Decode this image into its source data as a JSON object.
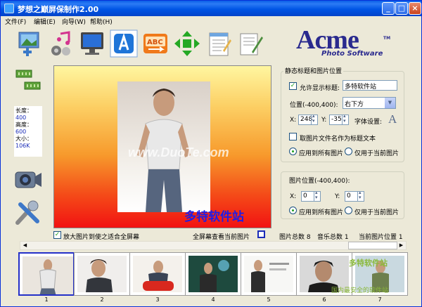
{
  "window": {
    "title": "梦想之巅屏保制作2.00",
    "min": "_",
    "max": "□",
    "close": "×"
  },
  "menu": [
    "文件(F)",
    "编辑(E)",
    "向导(W)",
    "帮助(H)"
  ],
  "logo": {
    "name": "Acme",
    "tm": "TM",
    "subtitle": "Photo Software"
  },
  "toolbar_icons": [
    "add-photo-icon",
    "music-icon",
    "monitor-icon",
    "text-a-icon",
    "abc-icon",
    "move-arrows-icon",
    "notepad-icon",
    "document-edit-icon"
  ],
  "side_icons": [
    "music-track-icon",
    "camera-icon",
    "tools-icon"
  ],
  "info": {
    "length_label": "长度：",
    "length_value": "400",
    "height_label": "高度：",
    "height_value": "600",
    "size_label": "大小：",
    "size_value": "106K"
  },
  "preview": {
    "caption": "多特软件站",
    "watermark": "www.DuoTe.com"
  },
  "title_group": {
    "legend": "静态标题和图片位置",
    "show_title_label": "允许显示标题:",
    "show_title_checked": true,
    "title_value": "多特软件站",
    "position_label": "位置(-400,400):",
    "position_select": "右下方",
    "x_label": "X:",
    "x_value": "248",
    "y_label": "Y:",
    "y_value": "-35",
    "font_label": "字体设置:",
    "font_glyph": "A",
    "use_filename_label": "取图片文件名作为标题文本",
    "apply_all_label": "应用到所有图片",
    "apply_current_label": "仅用于当前图片"
  },
  "image_group": {
    "legend": "图片位置(-400,400):",
    "x_label": "X:",
    "x_value": "0",
    "y_label": "Y:",
    "y_value": "0",
    "apply_all_label": "应用到所有图片",
    "apply_current_label": "仅用于当前图片"
  },
  "bottom": {
    "enlarge_label": "放大图片到使之适合全屏幕",
    "fullscreen_label": "全屏幕查看当前图片",
    "total_pics": "图片总数 8",
    "total_music": "音乐总数 1",
    "current_pic": "当前图片位置 1"
  },
  "thumbnails": [
    "1",
    "2",
    "3",
    "4",
    "5",
    "6",
    "7"
  ],
  "site_watermark": {
    "line1": "多特软件站",
    "line2": "国内最安全的软件站"
  }
}
